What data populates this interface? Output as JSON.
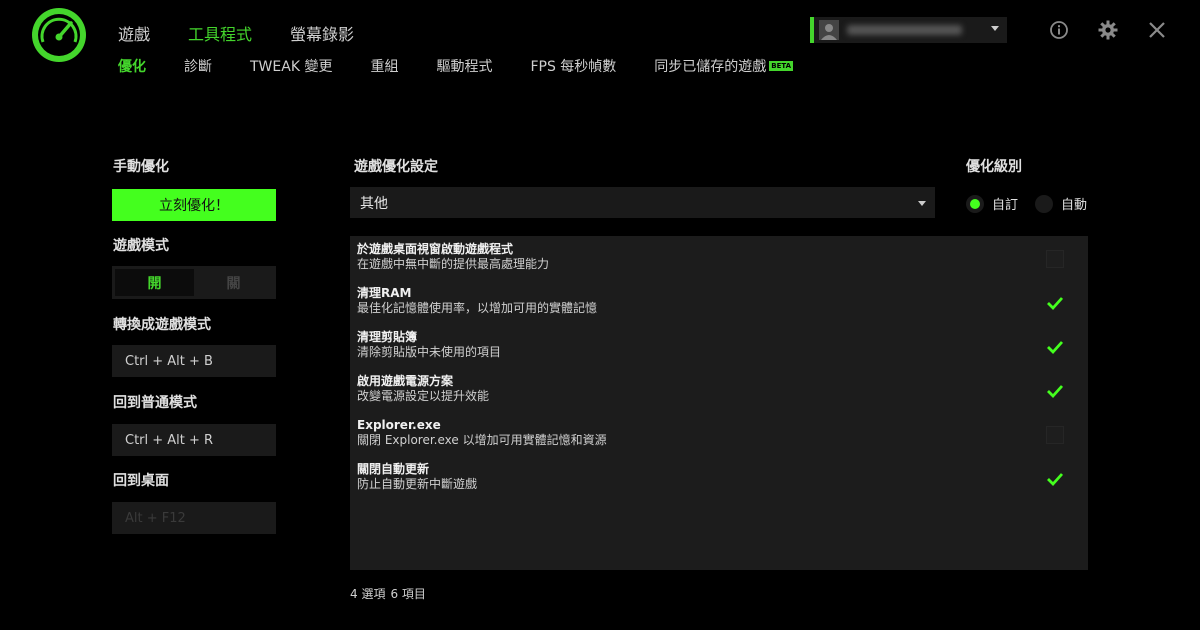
{
  "nav": {
    "main_tabs": [
      "遊戲",
      "工具程式",
      "螢幕錄影"
    ],
    "sub_tabs": [
      "優化",
      "診斷",
      "TWEAK 變更",
      "重組",
      "驅動程式",
      "FPS 每秒幀數",
      "同步已儲存的遊戲"
    ],
    "beta_badge": "BETA"
  },
  "left": {
    "manual_label": "手動優化",
    "optimize_button": "立刻優化！",
    "game_mode_label": "遊戲模式",
    "toggle_on": "開",
    "toggle_off": "關",
    "switch_label": "轉換成遊戲模式",
    "switch_hotkey": "Ctrl + Alt + B",
    "normal_label": "回到普通模式",
    "normal_hotkey": "Ctrl + Alt + R",
    "desktop_label": "回到桌面",
    "desktop_hotkey": "Alt + F12"
  },
  "middle": {
    "title": "遊戲優化設定",
    "selected_game": "其他",
    "items": [
      {
        "name": "於遊戲桌面視窗啟動遊戲程式",
        "desc": "在遊戲中無中斷的提供最高處理能力",
        "checked": false
      },
      {
        "name": "清理RAM",
        "desc": "最佳化記憶體使用率，以增加可用的實體記憶",
        "checked": true
      },
      {
        "name": "清理剪貼簿",
        "desc": "清除剪貼版中未使用的項目",
        "checked": true
      },
      {
        "name": "啟用遊戲電源方案",
        "desc": "改變電源設定以提升效能",
        "checked": true
      },
      {
        "name": "Explorer.exe",
        "desc": "關閉 Explorer.exe 以增加可用實體記憶和資源",
        "checked": false
      },
      {
        "name": "關閉自動更新",
        "desc": "防止自動更新中斷遊戲",
        "checked": true
      }
    ],
    "count_selected": "4 選項",
    "count_total": "6 項目"
  },
  "right": {
    "title": "優化級別",
    "custom": "自訂",
    "auto": "自動",
    "selected": "custom"
  },
  "icons": {
    "logo": "razer-cortex-gauge-icon",
    "info": "info-icon",
    "settings": "gear-icon",
    "close": "close-icon"
  },
  "colors": {
    "accent": "#44d62c",
    "button_green": "#44ff1e",
    "panel": "#1a1a1a"
  }
}
